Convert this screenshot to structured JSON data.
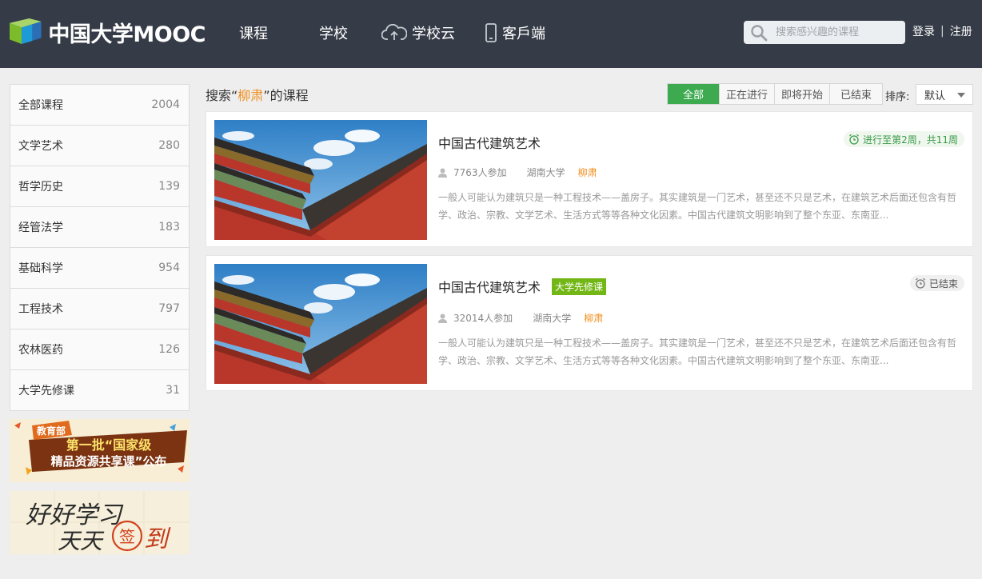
{
  "header": {
    "logo_text": "中国大学MOOC",
    "nav": [
      {
        "label": "课程",
        "icon": ""
      },
      {
        "label": "学校",
        "icon": ""
      },
      {
        "label": "学校云",
        "icon": "cloud-upload-icon"
      },
      {
        "label": "客戶端",
        "icon": "phone-icon"
      }
    ],
    "search_placeholder": "搜索感兴趣的课程",
    "login": "登录",
    "separator": "|",
    "register": "注册"
  },
  "sidebar": {
    "categories": [
      {
        "label": "全部课程",
        "count": "2004"
      },
      {
        "label": "文学艺术",
        "count": "280"
      },
      {
        "label": "哲学历史",
        "count": "139"
      },
      {
        "label": "经管法学",
        "count": "183"
      },
      {
        "label": "基础科学",
        "count": "954"
      },
      {
        "label": "工程技术",
        "count": "797"
      },
      {
        "label": "农林医药",
        "count": "126"
      },
      {
        "label": "大学先修课",
        "count": "31"
      }
    ],
    "banner1": {
      "badge": "教育部",
      "line1": "第一批“国家级",
      "line2": "精品资源共享课”公布"
    },
    "banner2": {
      "line1": "好好学习",
      "line2": "天天",
      "seal": "签",
      "line3": "到"
    }
  },
  "results": {
    "prefix": "搜索“",
    "keyword": "柳肃",
    "suffix": "”的课程",
    "filters": [
      "全部",
      "正在进行",
      "即将开始",
      "已结束"
    ],
    "sort_label": "排序:",
    "sort_value": "默认"
  },
  "courses": [
    {
      "title": "中国古代建筑艺术",
      "tag": "",
      "status": "进行至第2周，共11周",
      "status_type": "ongoing",
      "participants": "7763人参加",
      "school": "湖南大学",
      "teacher": "柳肃",
      "desc": "一般人可能认为建筑只是一种工程技术——盖房子。其实建筑是一门艺术，甚至还不只是艺术，在建筑艺术后面还包含有哲学、政治、宗教、文学艺术、生活方式等等各种文化因素。中国古代建筑文明影响到了整个东亚、东南亚..."
    },
    {
      "title": "中国古代建筑艺术",
      "tag": "大学先修课",
      "status": "已结束",
      "status_type": "ended",
      "participants": "32014人参加",
      "school": "湖南大学",
      "teacher": "柳肃",
      "desc": "一般人可能认为建筑只是一种工程技术——盖房子。其实建筑是一门艺术，甚至还不只是艺术，在建筑艺术后面还包含有哲学、政治、宗教、文学艺术、生活方式等等各种文化因素。中国古代建筑文明影响到了整个东亚、东南亚..."
    }
  ],
  "colors": {
    "header_bg": "#363c47",
    "accent_green": "#3daa50",
    "keyword_orange": "#f08d1a",
    "tag_green": "#73b716"
  }
}
